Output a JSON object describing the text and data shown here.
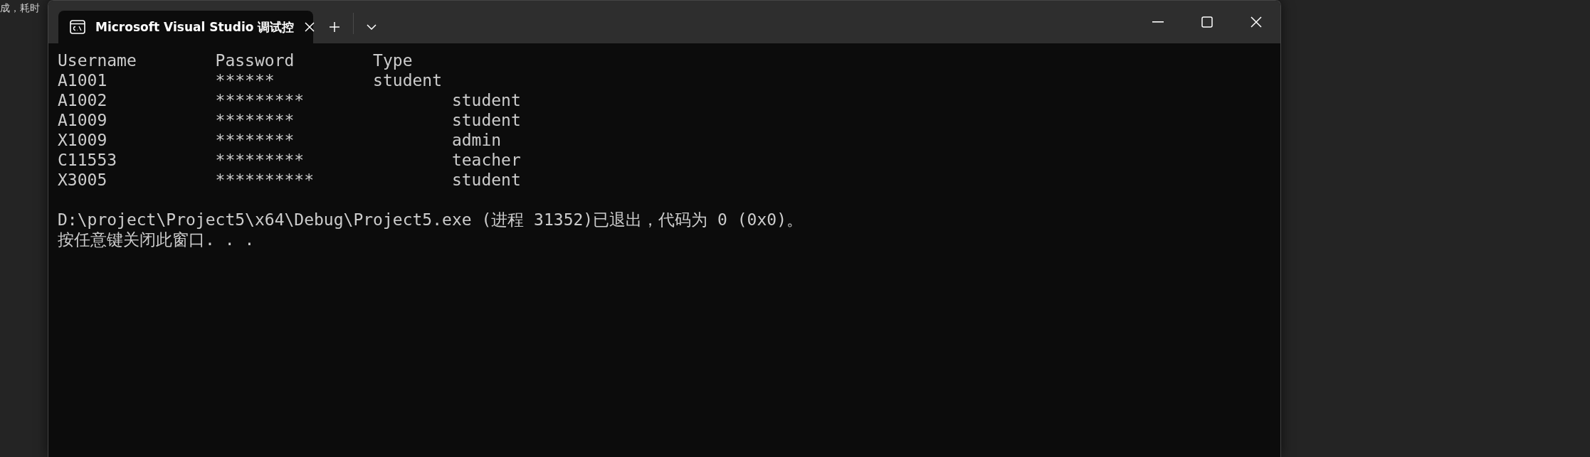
{
  "background_text": "成，耗时",
  "window": {
    "tab": {
      "title": "Microsoft Visual Studio 调试控",
      "selected": true
    }
  },
  "console": {
    "table_lines": [
      "Username        Password        Type",
      "A1001           ******          student",
      "A1002           *********               student",
      "A1009           ********                student",
      "X1009           ********                admin",
      "C11553          *********               teacher",
      "X3005           **********              student"
    ],
    "exit_lines": [
      "D:\\project\\Project5\\x64\\Debug\\Project5.exe (进程 31352)已退出，代码为 0 (0x0)。",
      "按任意键关闭此窗口. . ."
    ]
  }
}
